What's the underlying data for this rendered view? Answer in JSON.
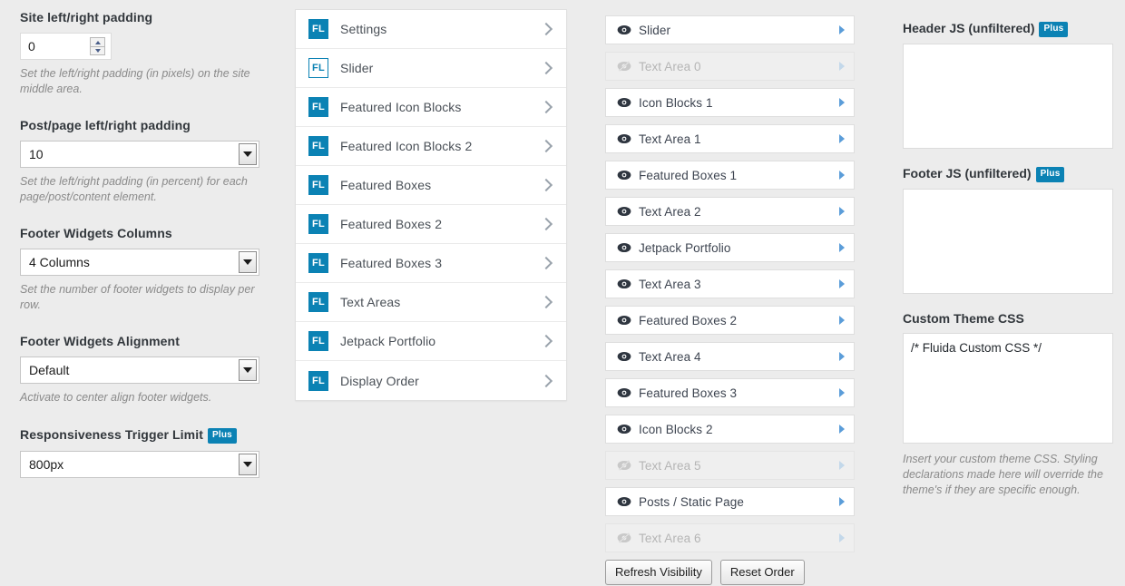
{
  "options_column": {
    "fields": [
      {
        "label": "Site left/right padding",
        "plus": false,
        "control": "number",
        "value": "0",
        "description": "Set the left/right padding (in pixels) on the site middle area."
      },
      {
        "label": "Post/page left/right padding",
        "plus": false,
        "control": "select",
        "value": "10",
        "description": "Set the left/right padding (in percent) for each page/post/content element."
      },
      {
        "label": "Footer Widgets Columns",
        "plus": false,
        "control": "select",
        "value": "4 Columns",
        "description": "Set the number of footer widgets to display per row."
      },
      {
        "label": "Footer Widgets Alignment",
        "plus": false,
        "control": "select",
        "value": "Default",
        "description": "Activate to center align footer widgets."
      },
      {
        "label": "Responsiveness Trigger Limit",
        "plus": true,
        "control": "select",
        "value": "800px",
        "description": ""
      }
    ],
    "plus_badge_label": "Plus"
  },
  "settings_column": {
    "items": [
      {
        "label": "Settings",
        "icon": "fl-badge-icon",
        "icon_style": "solid"
      },
      {
        "label": "Slider",
        "icon": "fl-badge-icon",
        "icon_style": "outline"
      },
      {
        "label": "Featured Icon Blocks",
        "icon": "fl-badge-icon",
        "icon_style": "solid"
      },
      {
        "label": "Featured Icon Blocks 2",
        "icon": "fl-badge-icon",
        "icon_style": "solid"
      },
      {
        "label": "Featured Boxes",
        "icon": "fl-badge-icon",
        "icon_style": "solid"
      },
      {
        "label": "Featured Boxes 2",
        "icon": "fl-badge-icon",
        "icon_style": "solid"
      },
      {
        "label": "Featured Boxes 3",
        "icon": "fl-badge-icon",
        "icon_style": "solid"
      },
      {
        "label": "Text Areas",
        "icon": "fl-badge-icon",
        "icon_style": "solid"
      },
      {
        "label": "Jetpack Portfolio",
        "icon": "fl-badge-icon",
        "icon_style": "solid"
      },
      {
        "label": "Display Order",
        "icon": "fl-badge-icon",
        "icon_style": "solid"
      }
    ],
    "badge_text": "FL",
    "chevron_icon": "chevron-right-icon"
  },
  "visibility_column": {
    "items": [
      {
        "label": "Slider",
        "visible": true
      },
      {
        "label": "Text Area 0",
        "visible": false
      },
      {
        "label": "Icon Blocks 1",
        "visible": true
      },
      {
        "label": "Text Area 1",
        "visible": true
      },
      {
        "label": "Featured Boxes 1",
        "visible": true
      },
      {
        "label": "Text Area 2",
        "visible": true
      },
      {
        "label": "Jetpack Portfolio",
        "visible": true
      },
      {
        "label": "Text Area 3",
        "visible": true
      },
      {
        "label": "Featured Boxes 2",
        "visible": true
      },
      {
        "label": "Text Area 4",
        "visible": true
      },
      {
        "label": "Featured Boxes 3",
        "visible": true
      },
      {
        "label": "Icon Blocks 2",
        "visible": true
      },
      {
        "label": "Text Area 5",
        "visible": false
      },
      {
        "label": "Posts / Static Page",
        "visible": true
      },
      {
        "label": "Text Area 6",
        "visible": false
      }
    ],
    "refresh_button": "Refresh Visibility",
    "reset_button": "Reset Order"
  },
  "code_column": {
    "header_js": {
      "label": "Header JS (unfiltered)",
      "plus": true,
      "value": ""
    },
    "footer_js": {
      "label": "Footer JS (unfiltered)",
      "plus": true,
      "value": ""
    },
    "custom_css": {
      "label": "Custom Theme CSS",
      "plus": false,
      "value": "/* Fluida Custom CSS */",
      "description": "Insert your custom theme CSS. Styling declarations made here will override the theme's if they are specific enough."
    },
    "plus_badge_label": "Plus"
  },
  "colors": {
    "accent": "#0b82b4",
    "page_background": "#ececec",
    "panel_background": "#ffffff",
    "text": "#32373c",
    "muted_text": "#8a8a8a",
    "triangle_blue": "#5b9dd9"
  }
}
